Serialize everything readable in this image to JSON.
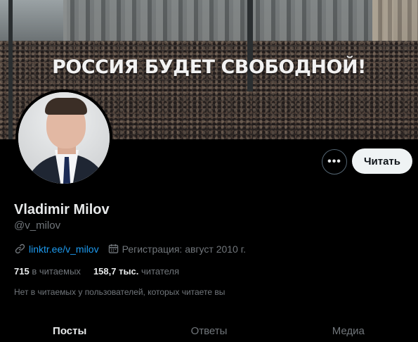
{
  "banner": {
    "slogan": "РОССИЯ БУДЕТ СВОБОДНОЙ!"
  },
  "profile": {
    "name": "Vladimir Milov",
    "handle": "@v_milov",
    "link": "linktr.ee/v_milov",
    "joined": "Регистрация: август 2010 г."
  },
  "actions": {
    "more_label": "•••",
    "follow_label": "Читать"
  },
  "stats": {
    "following_count": "715",
    "following_label": "в читаемых",
    "followers_count": "158,7 тыс.",
    "followers_label": "читателя"
  },
  "mutual_text": "Нет в читаемых у пользователей, которых читаете вы",
  "tabs": [
    {
      "label": "Посты",
      "active": true
    },
    {
      "label": "Ответы",
      "active": false
    },
    {
      "label": "Медиа",
      "active": false
    }
  ],
  "colors": {
    "accent": "#1d9bf0",
    "background": "#000000",
    "muted": "#71767b"
  },
  "icons": [
    "link-icon",
    "calendar-icon",
    "more-icon"
  ]
}
